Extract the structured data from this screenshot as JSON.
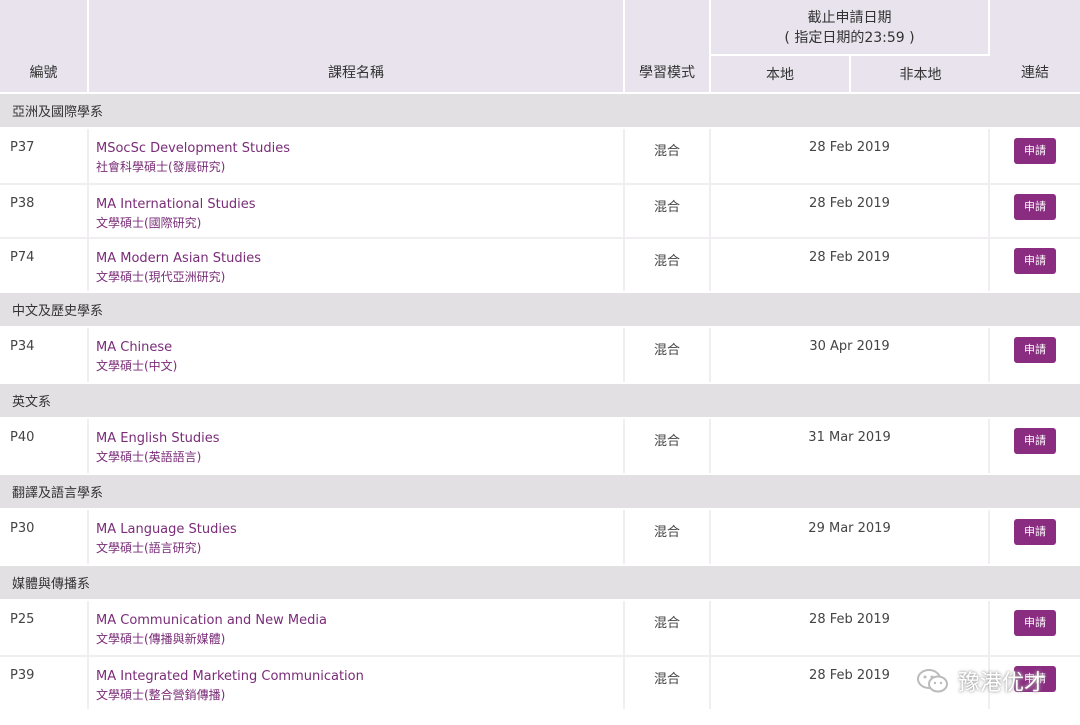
{
  "header": {
    "col_code": "編號",
    "col_name": "課程名稱",
    "col_mode": "學習模式",
    "col_deadline_line1": "截止申請日期",
    "col_deadline_line2": "( 指定日期的23:59 )",
    "col_local": "本地",
    "col_nonlocal": "非本地",
    "col_link": "連結"
  },
  "apply_label": "申請",
  "colors": {
    "header_bg": "#e8e3ec",
    "dept_bg": "#e3e0e3",
    "link_text": "#7a2c78",
    "button_bg": "#8a2d80"
  },
  "departments": [
    {
      "name": "亞洲及國際學系",
      "programmes": [
        {
          "code": "P37",
          "name_en": "MSocSc Development Studies",
          "name_zh": "社會科學碩士(發展研究)",
          "mode": "混合",
          "deadline": "28 Feb 2019"
        },
        {
          "code": "P38",
          "name_en": "MA International Studies",
          "name_zh": "文學碩士(國際研究)",
          "mode": "混合",
          "deadline": "28 Feb 2019"
        },
        {
          "code": "P74",
          "name_en": "MA Modern Asian Studies",
          "name_zh": "文學碩士(現代亞洲研究)",
          "mode": "混合",
          "deadline": "28 Feb 2019"
        }
      ]
    },
    {
      "name": "中文及歷史學系",
      "programmes": [
        {
          "code": "P34",
          "name_en": "MA Chinese",
          "name_zh": "文學碩士(中文)",
          "mode": "混合",
          "deadline": "30 Apr 2019"
        }
      ]
    },
    {
      "name": "英文系",
      "programmes": [
        {
          "code": "P40",
          "name_en": "MA English Studies",
          "name_zh": "文學碩士(英語語言)",
          "mode": "混合",
          "deadline": "31 Mar 2019"
        }
      ]
    },
    {
      "name": "翻譯及語言學系",
      "programmes": [
        {
          "code": "P30",
          "name_en": "MA Language Studies",
          "name_zh": "文學碩士(語言研究)",
          "mode": "混合",
          "deadline": "29 Mar 2019"
        }
      ]
    },
    {
      "name": "媒體與傳播系",
      "programmes": [
        {
          "code": "P25",
          "name_en": "MA Communication and New Media",
          "name_zh": "文學碩士(傳播與新媒體)",
          "mode": "混合",
          "deadline": "28 Feb 2019"
        },
        {
          "code": "P39",
          "name_en": "MA Integrated Marketing Communication",
          "name_zh": "文學碩士(整合營銷傳播)",
          "mode": "混合",
          "deadline": "28 Feb 2019"
        }
      ]
    }
  ],
  "watermark": {
    "text": "豫港优才",
    "icon": "wechat-icon"
  }
}
